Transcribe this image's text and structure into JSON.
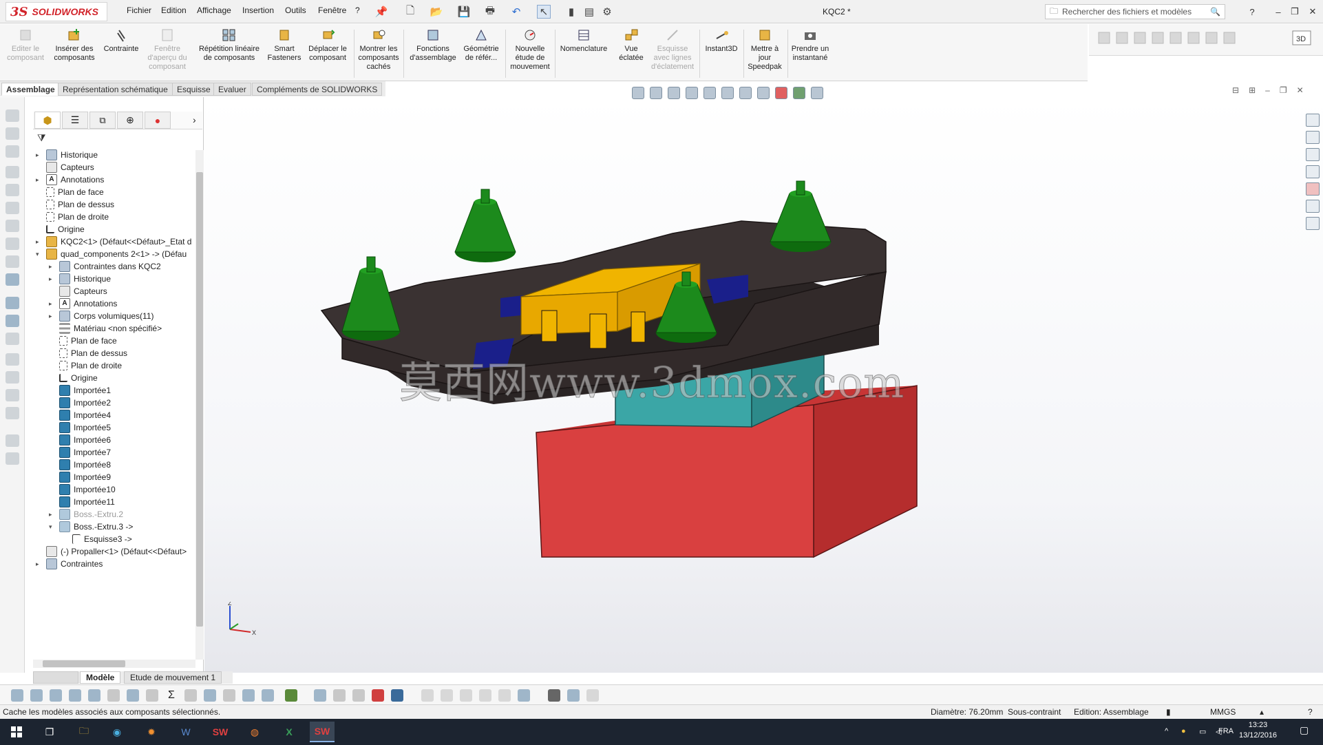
{
  "app": {
    "logo_ds": "3S",
    "logo_text": "SOLIDWORKS",
    "document_title": "KQC2 *"
  },
  "menu": [
    "Fichier",
    "Edition",
    "Affichage",
    "Insertion",
    "Outils",
    "Fenêtre",
    "?"
  ],
  "search": {
    "placeholder": "Rechercher des fichiers et modèles"
  },
  "ribbon": {
    "editer": "Editer le composant",
    "inserer": "Insérer des composants",
    "contrainte": "Contrainte",
    "fenetre": "Fenêtre d'aperçu du composant",
    "repetition": "Répétition linéaire de composants",
    "smart": "Smart Fasteners",
    "deplacer": "Déplacer le composant",
    "montrer": "Montrer les composants cachés",
    "fonctions": "Fonctions d'assemblage",
    "geometrie": "Géométrie de référ...",
    "nouvelle": "Nouvelle étude de mouvement",
    "nomenclature": "Nomenclature",
    "vue": "Vue éclatée",
    "esquisse_lignes": "Esquisse avec lignes d'éclatement",
    "instant3d": "Instant3D",
    "speedpak": "Mettre à jour Speedpak",
    "instantane": "Prendre un instantané"
  },
  "tabs": [
    "Assemblage",
    "Représentation schématique",
    "Esquisse",
    "Evaluer",
    "Compléments de SOLIDWORKS"
  ],
  "tree": [
    {
      "label": "Historique",
      "icon": "history-icon",
      "arrow": "▸",
      "level": 0
    },
    {
      "label": "Capteurs",
      "icon": "sensor-icon",
      "arrow": "",
      "level": 0
    },
    {
      "label": "Annotations",
      "icon": "annotation-icon",
      "arrow": "▸",
      "level": 0
    },
    {
      "label": "Plan de face",
      "icon": "plane-icon",
      "arrow": "",
      "level": 0
    },
    {
      "label": "Plan de dessus",
      "icon": "plane-icon",
      "arrow": "",
      "level": 0
    },
    {
      "label": "Plan de droite",
      "icon": "plane-icon",
      "arrow": "",
      "level": 0
    },
    {
      "label": "Origine",
      "icon": "origin-icon",
      "arrow": "",
      "level": 0
    },
    {
      "label": "KQC2<1> (Défaut<<Défaut>_Etat d",
      "icon": "assembly-icon",
      "arrow": "▸",
      "level": 0
    },
    {
      "label": "quad_components 2<1> -> (Défau",
      "icon": "assembly-icon",
      "arrow": "▾",
      "level": 0
    },
    {
      "label": "Contraintes dans KQC2",
      "icon": "mates-icon",
      "arrow": "▸",
      "level": 1
    },
    {
      "label": "Historique",
      "icon": "history-icon",
      "arrow": "▸",
      "level": 1
    },
    {
      "label": "Capteurs",
      "icon": "sensor-icon",
      "arrow": "",
      "level": 1
    },
    {
      "label": "Annotations",
      "icon": "annotation-icon",
      "arrow": "▸",
      "level": 1
    },
    {
      "label": "Corps volumiques(11)",
      "icon": "solid-bodies-icon",
      "arrow": "▸",
      "level": 1
    },
    {
      "label": "Matériau <non spécifié>",
      "icon": "material-icon",
      "arrow": "",
      "level": 1
    },
    {
      "label": "Plan de face",
      "icon": "plane-icon",
      "arrow": "",
      "level": 1
    },
    {
      "label": "Plan de dessus",
      "icon": "plane-icon",
      "arrow": "",
      "level": 1
    },
    {
      "label": "Plan de droite",
      "icon": "plane-icon",
      "arrow": "",
      "level": 1
    },
    {
      "label": "Origine",
      "icon": "origin-icon",
      "arrow": "",
      "level": 1
    },
    {
      "label": "Importée1",
      "icon": "imported-icon",
      "arrow": "",
      "level": 1
    },
    {
      "label": "Importée2",
      "icon": "imported-icon",
      "arrow": "",
      "level": 1
    },
    {
      "label": "Importée4",
      "icon": "imported-icon",
      "arrow": "",
      "level": 1
    },
    {
      "label": "Importée5",
      "icon": "imported-icon",
      "arrow": "",
      "level": 1
    },
    {
      "label": "Importée6",
      "icon": "imported-icon",
      "arrow": "",
      "level": 1
    },
    {
      "label": "Importée7",
      "icon": "imported-icon",
      "arrow": "",
      "level": 1
    },
    {
      "label": "Importée8",
      "icon": "imported-icon",
      "arrow": "",
      "level": 1
    },
    {
      "label": "Importée9",
      "icon": "imported-icon",
      "arrow": "",
      "level": 1
    },
    {
      "label": "Importée10",
      "icon": "imported-icon",
      "arrow": "",
      "level": 1
    },
    {
      "label": "Importée11",
      "icon": "imported-icon",
      "arrow": "",
      "level": 1
    },
    {
      "label": "Boss.-Extru.2",
      "icon": "extrude-icon",
      "arrow": "▸",
      "level": 1,
      "grey": true
    },
    {
      "label": "Boss.-Extru.3 ->",
      "icon": "extrude-icon",
      "arrow": "▾",
      "level": 1
    },
    {
      "label": "Esquisse3 ->",
      "icon": "sketch-icon",
      "arrow": "",
      "level": 2
    },
    {
      "label": "(-) Propaller<1> (Défaut<<Défaut>",
      "icon": "part-icon",
      "arrow": "",
      "level": 0
    },
    {
      "label": "Contraintes",
      "icon": "mates-icon",
      "arrow": "▸",
      "level": 0
    }
  ],
  "watermark": "莫西网www.3dmox.com",
  "model_tabs": [
    "Modèle",
    "Etude de mouvement 1"
  ],
  "status": {
    "message": "Cache les modèles associés aux composants sélectionnés.",
    "diameter": "Diamètre: 76.20mm",
    "constraint": "Sous-contraint",
    "edition": "Edition: Assemblage",
    "units": "MMGS"
  },
  "taskbar": {
    "lang": "FRA",
    "time": "13:23",
    "date": "13/12/2016"
  },
  "colors": {
    "frame": "#3a3232",
    "motor": "#1c8a1c",
    "battery": "#f0b400",
    "accent_blue": "#1a1f8a",
    "stand_top": "#3ba6a6",
    "stand_base": "#d63c3c"
  }
}
